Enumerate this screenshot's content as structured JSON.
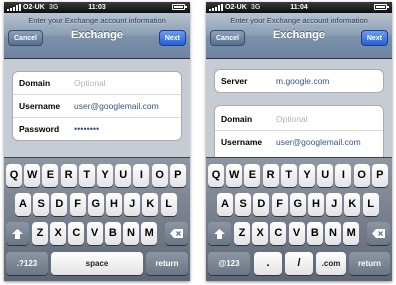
{
  "screens": [
    {
      "status": {
        "carrier": "O2-UK",
        "network": "3G",
        "time": "11:03"
      },
      "nav": {
        "prompt": "Enter your Exchange account information",
        "title": "Exchange",
        "cancel": "Cancel",
        "next": "Next"
      },
      "fields": [
        {
          "label": "Domain",
          "value": "Optional",
          "placeholder": true
        },
        {
          "label": "Username",
          "value": "user@googlemail.com",
          "placeholder": false
        },
        {
          "label": "Password",
          "value": "••••••••",
          "placeholder": false
        }
      ],
      "keyboard": {
        "row1": [
          "Q",
          "W",
          "E",
          "R",
          "T",
          "Y",
          "U",
          "I",
          "O",
          "P"
        ],
        "row2": [
          "A",
          "S",
          "D",
          "F",
          "G",
          "H",
          "J",
          "K",
          "L"
        ],
        "row3": [
          "Z",
          "X",
          "C",
          "V",
          "B",
          "N",
          "M"
        ],
        "mode": ".?123",
        "space": "space",
        "return": "return"
      }
    },
    {
      "status": {
        "carrier": "O2-UK",
        "network": "3G",
        "time": "11:04"
      },
      "nav": {
        "prompt": "Enter your Exchange account information",
        "title": "Exchange",
        "cancel": "Cancel",
        "next": "Next"
      },
      "server": {
        "label": "Server",
        "value": "m.google.com"
      },
      "fields": [
        {
          "label": "Domain",
          "value": "Optional",
          "placeholder": true
        },
        {
          "label": "Username",
          "value": "user@googlemail.com",
          "placeholder": false
        }
      ],
      "keyboard": {
        "row1": [
          "Q",
          "W",
          "E",
          "R",
          "T",
          "Y",
          "U",
          "I",
          "O",
          "P"
        ],
        "row2": [
          "A",
          "S",
          "D",
          "F",
          "G",
          "H",
          "J",
          "K",
          "L"
        ],
        "row3": [
          "Z",
          "X",
          "C",
          "V",
          "B",
          "N",
          "M"
        ],
        "mode": "@123",
        "dot": ".",
        "slash": "/",
        "dotcom": ".com",
        "return": "return"
      }
    }
  ],
  "icons": {
    "shift": "shift-arrow-icon",
    "delete": "delete-backspace-icon"
  },
  "colors": {
    "nav_button": "#566e8f",
    "next_button": "#2260dd",
    "value_text": "#385487"
  }
}
